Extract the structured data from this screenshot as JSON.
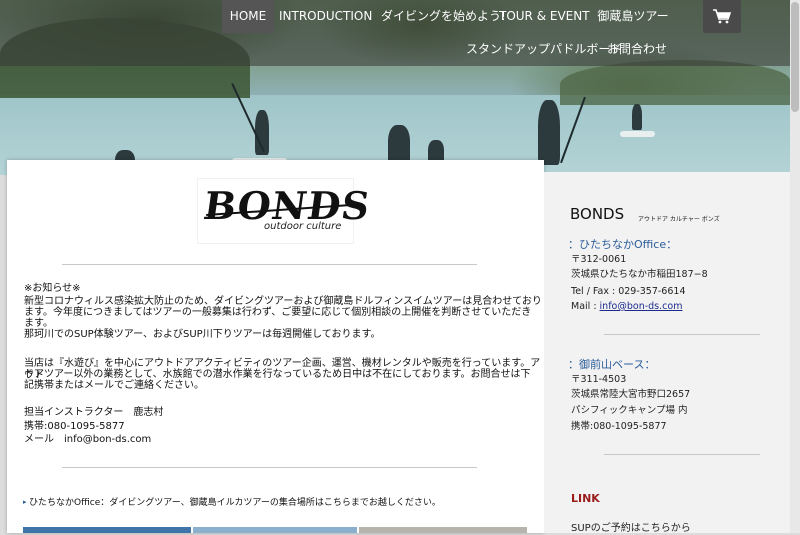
{
  "nav": {
    "items": [
      {
        "label": "HOME"
      },
      {
        "label": "INTRODUCTION"
      },
      {
        "label": "ダイビングを始めよう!"
      },
      {
        "label": "TOUR & EVENT"
      },
      {
        "label": "御蔵島ツアー"
      },
      {
        "label": "スタンドアップパドルボード"
      },
      {
        "label": "お問合わせ"
      }
    ],
    "cart_icon": "shopping-cart-icon"
  },
  "main": {
    "logo_word": "BONDS",
    "logo_sub": "outdoor culture",
    "notice_title": "※お知らせ※",
    "notice_lines": [
      "新型コロナウィルス感染拡大防止のため、ダイビングツアーおよび御蔵島ドルフィンスイムツアーは見合わせており",
      "ます。今年度につきましてはツアーの一般募集は行わず、ご要望に応じて個別相談の上開催を判断させていただき",
      "ます。",
      "那珂川でのSUP体験ツアー、およびSUP川下りツアーは毎週開催しております。"
    ],
    "about_lines": [
      "当店は『水遊び』を中心にアウトドアアクティビティのツアー企画、運営、機材レンタルや販売を行っています。アウト",
      "ドアツアー以外の業務として、水族館での潜水作業を行なっているため日中は不在にしております。お問合せは下",
      "記携帯またはメールでご連絡ください。"
    ],
    "contact_lines": [
      "担当インストラクター　鹿志村",
      "携帯:080-1095-5877",
      "メール　info@bon-ds.com"
    ],
    "meeting_text": "ひたちなかOffice：ダイビングツアー、御蔵島イルカツアーの集合場所はこちらまでお越しください。"
  },
  "sidebar": {
    "brand": "BONDS",
    "brand_kana": "アウトドア カルチャー ボンズ",
    "office1": {
      "title": "：ひたちなかOffice：",
      "zip": "〒312-0061",
      "address": "茨城県ひたちなか市稲田187−8",
      "tel": "Tel / Fax : 029-357-6614",
      "mail_label": "Mail : ",
      "mail": "info@bon-ds.com"
    },
    "office2": {
      "title": "：御前山ベース：",
      "zip": "〒311-4503",
      "address": "茨城県常陸大宮市野口2657",
      "place": "パシフィックキャンプ場 内",
      "phone": "携帯:080-1095-5877"
    },
    "link_title": "LINK",
    "sup_text": "SUPのご予約はこちらから"
  },
  "colors": {
    "accent_blue": "#2a5c9a",
    "link_red": "#9b1b1b",
    "nav_active": "#555555"
  }
}
